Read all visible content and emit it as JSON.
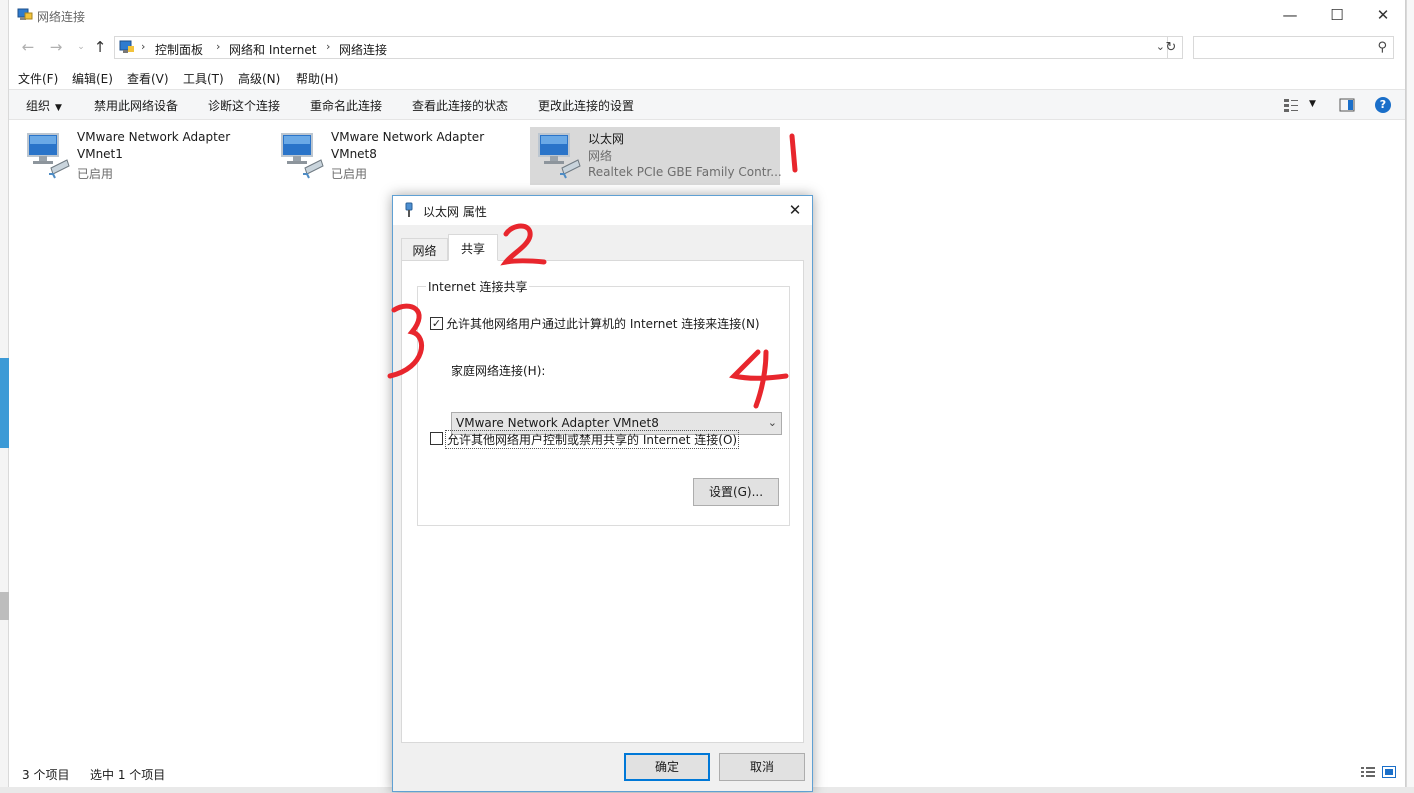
{
  "window": {
    "title": "网络连接"
  },
  "nav": {
    "breadcrumbs": [
      "控制面板",
      "网络和 Internet",
      "网络连接"
    ],
    "search_placeholder": ""
  },
  "menu": [
    "文件(F)",
    "编辑(E)",
    "查看(V)",
    "工具(T)",
    "高级(N)",
    "帮助(H)"
  ],
  "commands": {
    "organize": "组织",
    "disable": "禁用此网络设备",
    "diagnose": "诊断这个连接",
    "rename": "重命名此连接",
    "view_status": "查看此连接的状态",
    "change_settings": "更改此连接的设置"
  },
  "adapters": [
    {
      "name": "VMware Network Adapter",
      "line2": "VMnet1",
      "status": "已启用"
    },
    {
      "name": "VMware Network Adapter",
      "line2": "VMnet8",
      "status": "已启用"
    },
    {
      "name": "以太网",
      "line2": "网络",
      "device": "Realtek PCIe GBE Family Contr..."
    }
  ],
  "status": {
    "count": "3 个项目",
    "selected": "选中 1 个项目"
  },
  "dialog": {
    "title": "以太网 属性",
    "tabs": [
      "网络",
      "共享"
    ],
    "group_title": "Internet 连接共享",
    "allow_share": "允许其他网络用户通过此计算机的 Internet 连接来连接(N)",
    "allow_share_checked": true,
    "home_label": "家庭网络连接(H):",
    "home_value": "VMware Network Adapter VMnet8",
    "allow_control": "允许其他网络用户控制或禁用共享的 Internet 连接(O)",
    "allow_control_checked": false,
    "settings_button": "设置(G)...",
    "ok_button": "确定",
    "cancel_button": "取消"
  },
  "annotations": [
    "1",
    "2",
    "3",
    "4"
  ],
  "colors": {
    "accent": "#0078d7",
    "selected_bg": "#d9d9d9",
    "annotation": "#e8262d",
    "help": "#1a6fc9"
  }
}
